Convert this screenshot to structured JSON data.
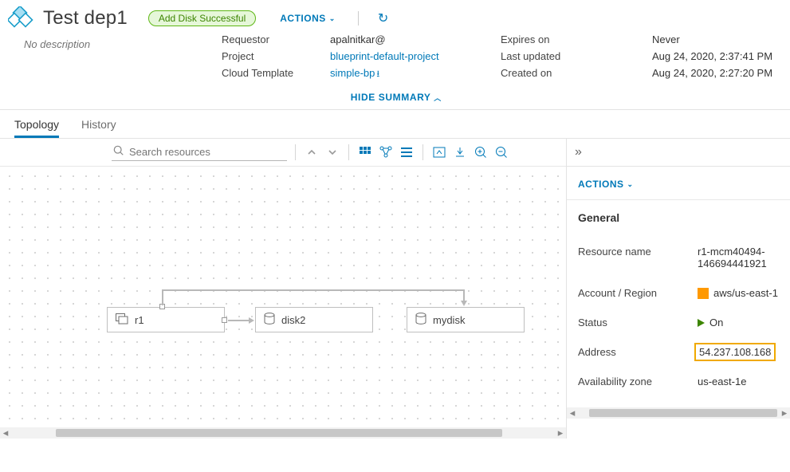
{
  "header": {
    "title": "Test dep1",
    "status_pill": "Add Disk Successful",
    "actions_label": "ACTIONS",
    "description": "No description"
  },
  "summary": {
    "left": {
      "requestor_label": "Requestor",
      "requestor_value": "apalnitkar@",
      "project_label": "Project",
      "project_value": "blueprint-default-project",
      "template_label": "Cloud Template",
      "template_value": "simple-bp"
    },
    "mid": {
      "expires_label": "Expires on",
      "updated_label": "Last updated",
      "created_label": "Created on"
    },
    "right": {
      "expires_value": "Never",
      "updated_value": "Aug 24, 2020, 2:37:41 PM",
      "created_value": "Aug 24, 2020, 2:27:20 PM"
    },
    "hide_label": "HIDE SUMMARY"
  },
  "tabs": {
    "topology": "Topology",
    "history": "History"
  },
  "toolbar": {
    "search_placeholder": "Search resources"
  },
  "canvas": {
    "nodes": {
      "r1": "r1",
      "disk2": "disk2",
      "mydisk": "mydisk"
    }
  },
  "side": {
    "actions_label": "ACTIONS",
    "section_title": "General",
    "rows": {
      "name_label": "Resource name",
      "name_value": "r1-mcm40494-146694441921",
      "account_label": "Account / Region",
      "account_value": "aws/us-east-1",
      "status_label": "Status",
      "status_value": "On",
      "address_label": "Address",
      "address_value": "54.237.108.168",
      "az_label": "Availability zone",
      "az_value": "us-east-1e"
    }
  }
}
